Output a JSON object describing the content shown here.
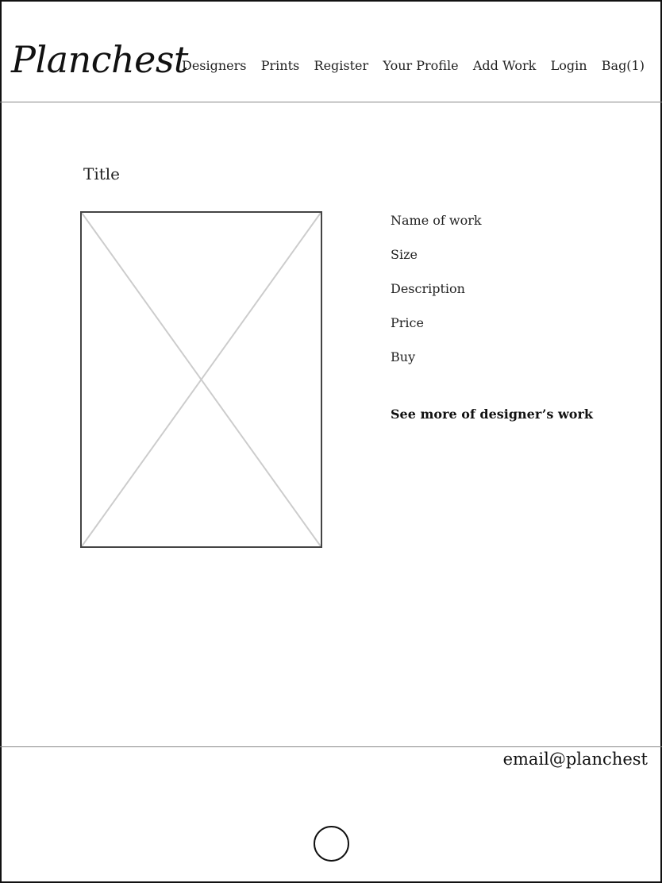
{
  "header": {
    "logo": "Planchest",
    "nav": [
      "Designers",
      "Prints",
      "Register",
      "Your Profile",
      "Add Work",
      "Login",
      "Bag(1)"
    ]
  },
  "main": {
    "title": "Title",
    "details": {
      "name": "Name of work",
      "size": "Size",
      "description": "Description",
      "price": "Price",
      "buy": "Buy"
    },
    "see_more": "See more of designer’s work"
  },
  "footer": {
    "email": "email@planchest"
  },
  "colors": {
    "border": "#111111",
    "divider": "#888888",
    "placeholder_cross": "#cccccc"
  }
}
